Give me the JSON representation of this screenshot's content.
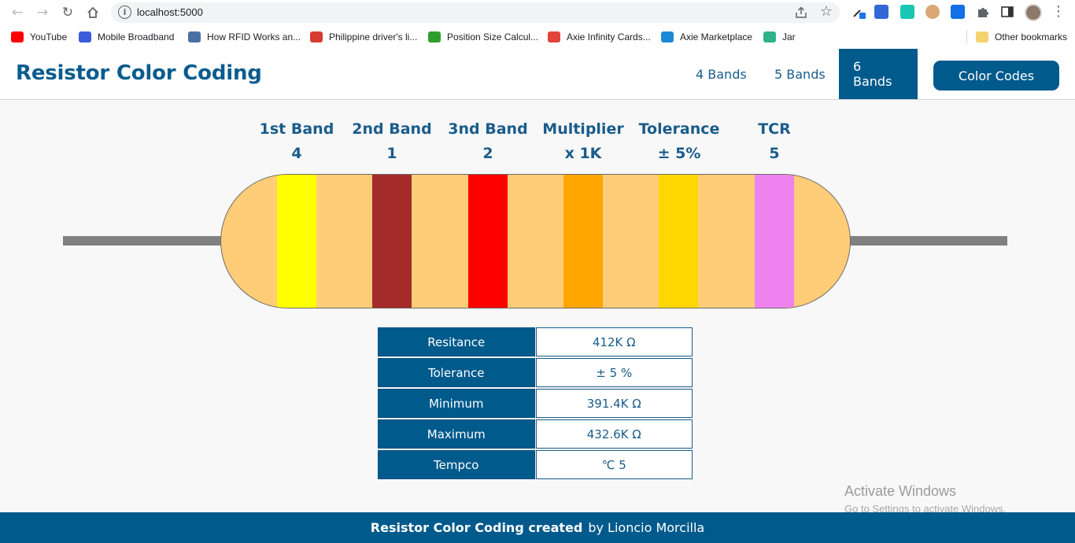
{
  "browser": {
    "url": "localhost:5000",
    "bookmarks": [
      {
        "label": "YouTube",
        "icon": "youtube-icon",
        "color": "#ff0000"
      },
      {
        "label": "Mobile Broadband",
        "icon": "globe-icon",
        "color": "#3b5bdb"
      },
      {
        "label": "How RFID Works an...",
        "icon": "m-logo-icon",
        "color": "#4a6fa5"
      },
      {
        "label": "Philippine driver's li...",
        "icon": "lto-logo-icon",
        "color": "#d63b2f"
      },
      {
        "label": "Position Size Calcul...",
        "icon": "b-logo-icon",
        "color": "#2e9e2e"
      },
      {
        "label": "Axie Infinity Cards...",
        "icon": "axie-cards-icon",
        "color": "#e0443b"
      },
      {
        "label": "Axie Marketplace",
        "icon": "axie-bow-icon",
        "color": "#1b8ad6"
      },
      {
        "label": "Jar",
        "icon": "jar-icon",
        "color": "#2db38a"
      }
    ],
    "other_bookmarks": "Other bookmarks"
  },
  "app": {
    "title": "Resistor Color Coding",
    "nav": {
      "four": "4 Bands",
      "five": "5 Bands",
      "six": "6 Bands",
      "active": "6 Bands"
    },
    "color_codes_button": "Color Codes"
  },
  "bands": [
    {
      "title": "1st Band",
      "value": "4",
      "color": "#ffff00"
    },
    {
      "title": "2nd Band",
      "value": "1",
      "color": "#a52a2a"
    },
    {
      "title": "3nd Band",
      "value": "2",
      "color": "#ff0000"
    },
    {
      "title": "Multiplier",
      "value": "x 1K",
      "color": "#ffa500"
    },
    {
      "title": "Tolerance",
      "value": "± 5%",
      "color": "#ffd700"
    },
    {
      "title": "TCR",
      "value": "5",
      "color": "#ee82ee"
    }
  ],
  "colors": {
    "body": "#ffcc77",
    "lead": "#808080",
    "primary": "#005a8c",
    "text": "#1a5c8a"
  },
  "results": [
    {
      "label": "Resitance",
      "value": "412K Ω"
    },
    {
      "label": "Tolerance",
      "value": "± 5 %"
    },
    {
      "label": "Minimum",
      "value": "391.4K Ω"
    },
    {
      "label": "Maximum",
      "value": "432.6K Ω"
    },
    {
      "label": "Tempco",
      "value": "℃ 5"
    }
  ],
  "watermark": {
    "title": "Activate Windows",
    "subtitle": "Go to Settings to activate Windows."
  },
  "footer": {
    "strong": "Resistor Color Coding created",
    "rest": "by Lioncio Morcilla"
  }
}
